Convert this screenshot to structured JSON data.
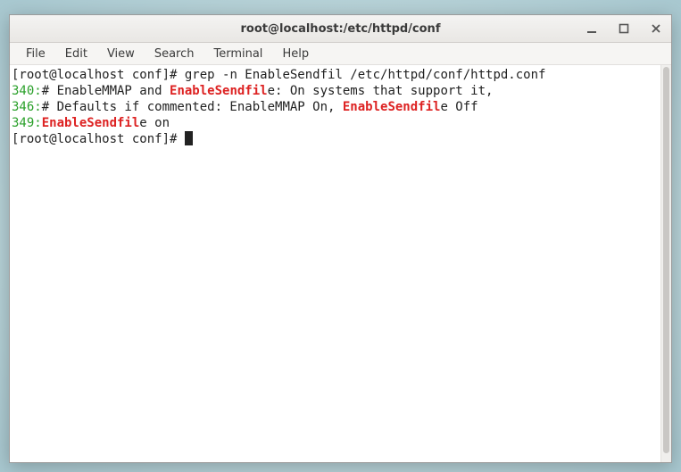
{
  "window": {
    "title": "root@localhost:/etc/httpd/conf"
  },
  "menubar": {
    "items": [
      "File",
      "Edit",
      "View",
      "Search",
      "Terminal",
      "Help"
    ]
  },
  "terminal": {
    "prompt1": "[root@localhost conf]# ",
    "command1": "grep -n EnableSendfil /etc/httpd/conf/httpd.conf",
    "lines": [
      {
        "num": "340:",
        "before": "# EnableMMAP and ",
        "match": "EnableSendfil",
        "after": "e: On systems that support it,"
      },
      {
        "num": "346:",
        "before": "# Defaults if commented: EnableMMAP On, ",
        "match": "EnableSendfil",
        "after": "e Off"
      },
      {
        "num": "349:",
        "before": "",
        "match": "EnableSendfil",
        "after": "e on"
      }
    ],
    "prompt2": "[root@localhost conf]# "
  }
}
